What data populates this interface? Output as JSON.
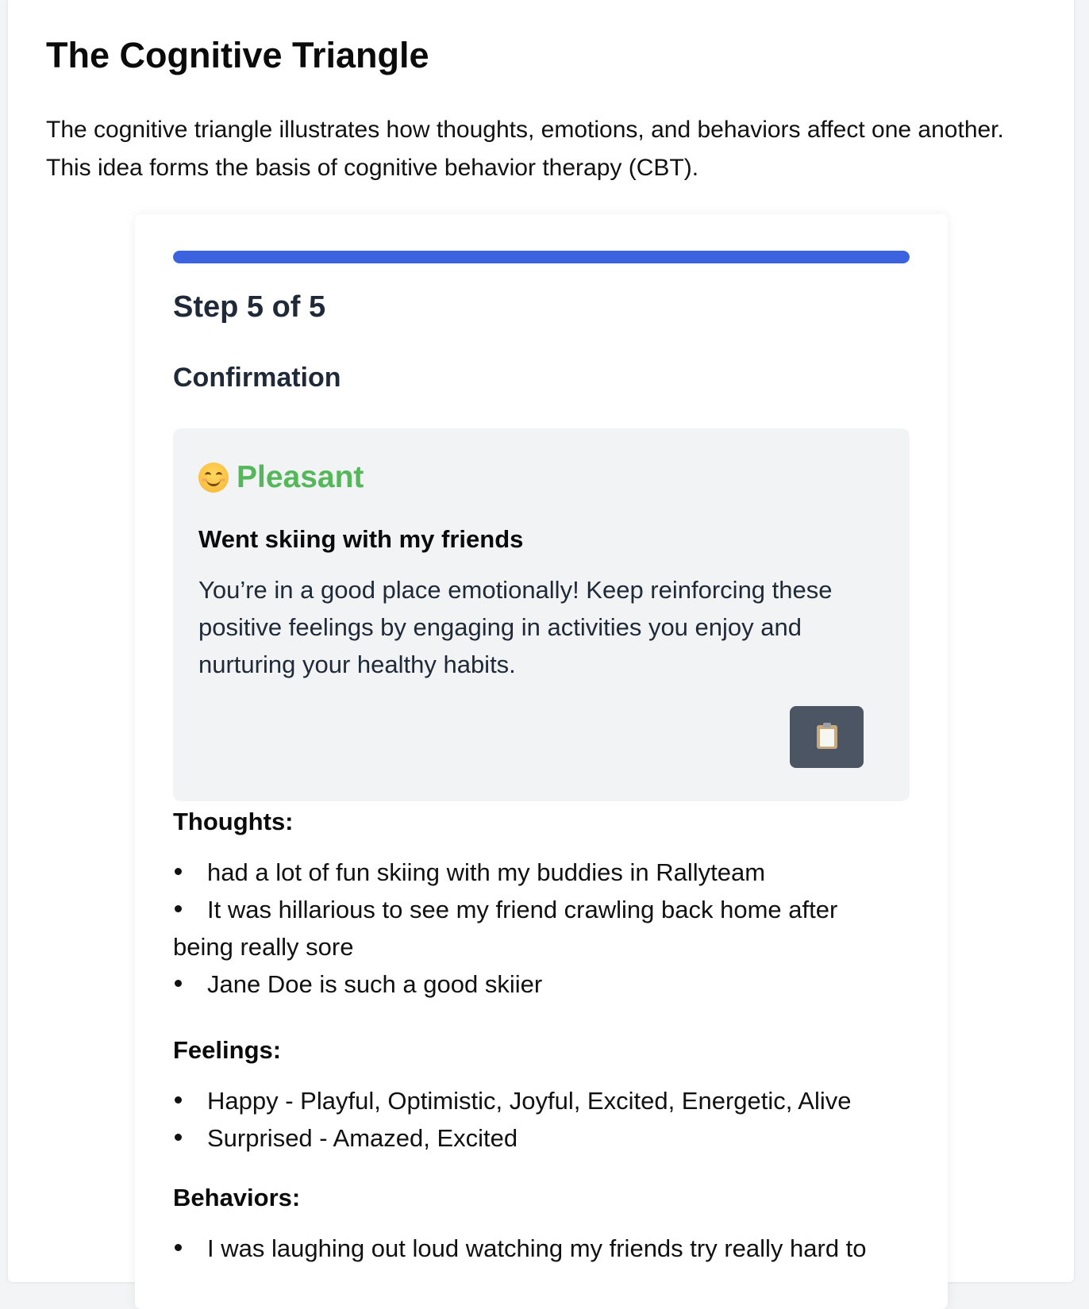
{
  "page": {
    "title": "The Cognitive Triangle",
    "intro": "The cognitive triangle illustrates how thoughts, emotions, and behaviors affect one another. This idea forms the basis of cognitive behavior therapy (CBT)."
  },
  "wizard": {
    "progress_fraction": 1.0,
    "step_label": "Step 5 of 5",
    "step_title": "Confirmation",
    "accent_color": "#3b63e0"
  },
  "summary": {
    "mood_icon": "smiling-face-icon",
    "mood_label": "Pleasant",
    "mood_color": "#54b85a",
    "event": "Went skiing with my friends",
    "advice": "You’re in a good place emotionally! Keep reinforcing these positive feelings by engaging in activities you enjoy and nurturing your healthy habits.",
    "copy_button_icon": "clipboard-icon"
  },
  "sections": {
    "thoughts": {
      "heading": "Thoughts:",
      "items": [
        "had a lot of fun skiing with my buddies in Rallyteam",
        "It was hillarious to see my friend crawling back home after being really sore",
        "Jane Doe is such a good skiier"
      ]
    },
    "feelings": {
      "heading": "Feelings:",
      "items": [
        "Happy - Playful, Optimistic, Joyful, Excited, Energetic, Alive",
        "Surprised - Amazed, Excited"
      ]
    },
    "behaviors": {
      "heading": "Behaviors:",
      "items": [
        "I was laughing out loud watching my friends try really hard to"
      ]
    }
  }
}
